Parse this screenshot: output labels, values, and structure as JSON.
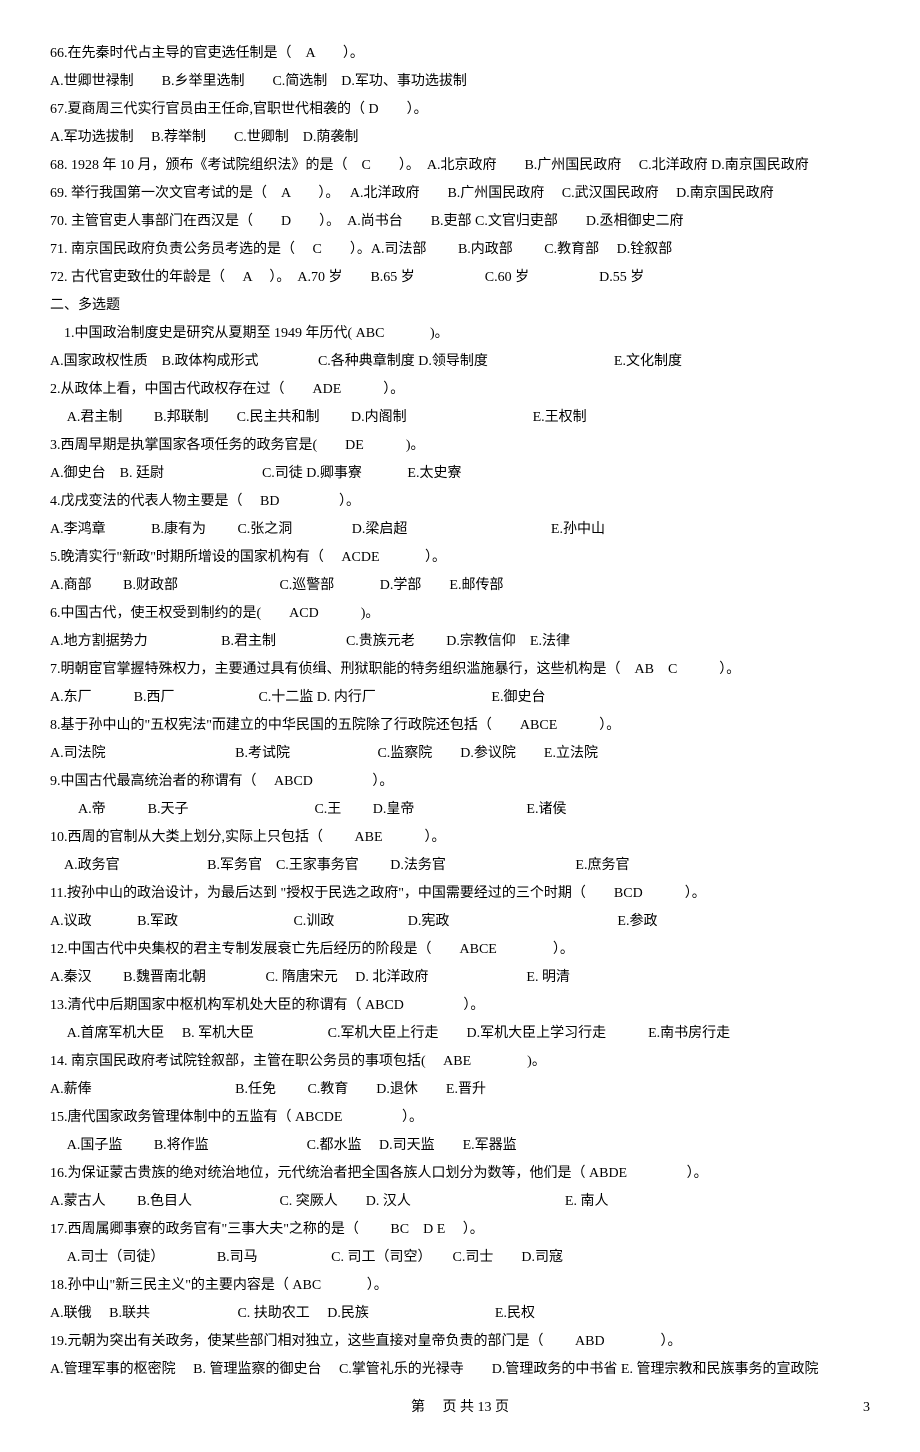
{
  "lines": [
    "66.在先秦时代占主导的官吏选任制是（　A　　）。",
    "A.世卿世禄制　　B.乡举里选制　　C.简选制　D.军功、事功选拔制",
    "67.夏商周三代实行官员由王任命,官职世代相袭的（ D　　）。",
    "A.军功选拔制　 B.荐举制　　C.世卿制　D.荫袭制",
    "68. 1928 年 10 月，颁布《考试院组织法》的是（　C　　）。　A.北京政府　　B.广州国民政府　 C.北洋政府 D.南京国民政府",
    "69. 举行我国第一次文官考试的是（　A　　）。　 A.北洋政府　　B.广州国民政府　 C.武汉国民政府　 D.南京国民政府",
    "70. 主管官吏人事部门在西汉是（　　D　　）。　A.尚书台　　B.吏部 C.文官归吏部　　D.丞相御史二府",
    "71. 南京国民政府负责公务员考选的是（　 C　　）。A.司法部　　 B.内政部　　 C.教育部　 D.铨叙部",
    "72. 古代官吏致仕的年龄是（　 A　 ）。　A.70 岁　　B.65 岁　　　　　C.60 岁　　　　　D.55 岁",
    "二、多选题",
    "　1.中国政治制度史是研究从夏期至 1949 年历代( ABC　 　　)。",
    "A.国家政权性质　B.政体构成形式　 　　　C.各种典章制度 D.领导制度　　　　　　　　　E.文化制度",
    "2.从政体上看，中国古代政权存在过（　　ADE　　　）。",
    "　 A.君主制　　 B.邦联制　　C.民主共和制　　 D.内阁制　　　　　　　　　E.王权制",
    "3.西周早期是执掌国家各项任务的政务官是(　　DE　　　)。",
    "A.御史台　B. 廷尉　　　　　　　C.司徒 D.卿事寮　 　　E.太史寮",
    "4.戊戌变法的代表人物主要是（　 BD　 　　　）。",
    "A.李鸿章　　　 B.康有为　　 C.张之洞　　　　 D.梁启超　　 　　　　　　　　E.孙中山",
    "5.晚清实行\"新政\"时期所增设的国家机构有（　 ACDE　 　　）。",
    "A.商部　　 B.财政部　　 　　　　　C.巡警部　　　 D.学部　　E.邮传部",
    "6.中国古代，使王权受到制约的是(　　ACD　　　)。",
    "A.地方割据势力　　　　　 B.君主制　　　　　C.贵族元老　　 D.宗教信仰　E.法律",
    "7.明朝宦官掌握特殊权力，主要通过具有侦缉、刑狱职能的特务组织滥施暴行，这些机构是（　AB　C　　　）。",
    "A.东厂　　　B.西厂　　　　　　C.十二监 D. 内行厂　 　　　　　　　E.御史台",
    "8.基于孙中山的\"五权宪法\"而建立的中华民国的五院除了行政院还包括（　　ABCE　　　）。",
    "A.司法院　　　　 　　　　　B.考试院　　　　　　 C.监察院　　D.参议院　　E.立法院",
    "9.中国古代最高统治者的称谓有（　 ABCD　 　　　）。",
    "　　A.帝　　　B.天子　　　　　　　　　C.王　　 D.皇帝　　　　　　　　E.诸侯",
    "10.西周的官制从大类上划分,实际上只包括（　 　ABE　　　）。",
    "　A.政务官　　　　　　 B.军务官　C.王家事务官　　 D.法务官　　　　 　　　　　E.庶务官",
    "11.按孙中山的政治设计，为最后达到 \"授权于民选之政府\"，中国需要经过的三个时期（　　BCD　　　）。",
    "A.议政　 　　B.军政　　　　　　　　 C.训政　 　　　　D.宪政　　　　　　　　　　　　E.参政",
    "12.中国古代中央集权的君主专制发展衰亡先后经历的阶段是（　　ABCE　　　　）。",
    "A.秦汉　　 B.魏晋南北朝　　　　 C. 隋唐宋元　 D. 北洋政府　　　　　　　E. 明清",
    "13.清代中后期国家中枢机构军机处大臣的称谓有（ ABCD　　 　　）。",
    "　 A.首席军机大臣　 B. 军机大臣　 　　　　C.军机大臣上行走　　D.军机大臣上学习行走　　　E.南书房行走",
    "14. 南京国民政府考试院铨叙部，主管在职公务员的事项包括(　 ABE　　　　)。",
    "A.薪俸　　　　　　　 　　　B.任免　　 C.教育　　D.退休　　E.晋升",
    "15.唐代国家政务管理体制中的五监有（ ABCDE　 　　　）。",
    "　 A.国子监　　 B.将作监　　　　　　　C.都水监　 D.司天监　　E.军器监",
    "16.为保证蒙古贵族的绝对统治地位，元代统治者把全国各族人口划分为数等，他们是（ ABDE　　 　　）。",
    "A.蒙古人　　 B.色目人　　　　　　 C. 突厥人　　D. 汉人　　　　　　　　　　　E. 南人",
    "17.西周属卿事寮的政务官有\"三事大夫\"之称的是（　　 BC　D E　 ）。",
    "　 A.司士（司徒）　　　　 B.司马　　　　　 C. 司工（司空）　　C.司士　　D.司寇",
    "18.孙中山\"新三民主义\"的主要内容是（ ABC　　　 ）。",
    "A.联俄　 B.联共 　　　　　　C. 扶助农工　 D.民族　　　　　　　　　E.民权",
    "19.元朝为突出有关政务，使某些部门相对独立，这些直接对皇帝负责的部门是（　　 ABD　　　　）。",
    "A.管理军事的枢密院　 B. 管理监察的御史台　 C.掌管礼乐的光禄寺　　D.管理政务的中书省 E. 管理宗教和民族事务的宣政院"
  ],
  "footer_center": "第　 页 共 13 页",
  "footer_right": "3"
}
